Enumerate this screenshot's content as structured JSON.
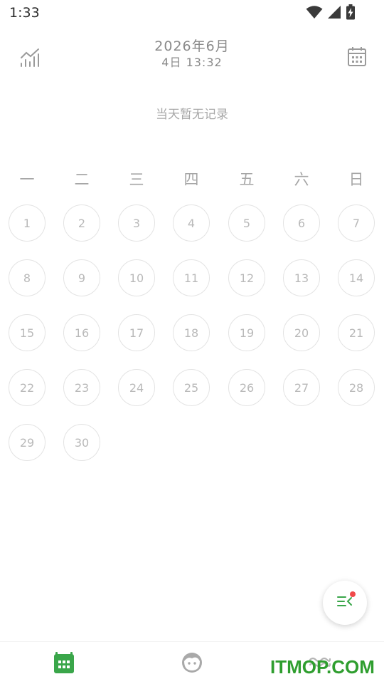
{
  "status_bar": {
    "time": "1:33",
    "icons": [
      "wifi-icon",
      "signal-icon",
      "battery-charging-icon"
    ]
  },
  "header": {
    "stats_icon": "stats-chart-icon",
    "date_line1": "2026年6月",
    "date_line2": "4日 13:32",
    "calendar_icon": "calendar-icon"
  },
  "empty_message": "当天暂无记录",
  "weekdays": [
    "一",
    "二",
    "三",
    "四",
    "五",
    "六",
    "日"
  ],
  "days": [
    "1",
    "2",
    "3",
    "4",
    "5",
    "6",
    "7",
    "8",
    "9",
    "10",
    "11",
    "12",
    "13",
    "14",
    "15",
    "16",
    "17",
    "18",
    "19",
    "20",
    "21",
    "22",
    "23",
    "24",
    "25",
    "26",
    "27",
    "28",
    "29",
    "30"
  ],
  "fab": {
    "icon": "menu-collapse-icon",
    "has_badge": true,
    "badge_color": "#f04a4a"
  },
  "bottom_nav": {
    "items": [
      {
        "icon": "calendar-icon",
        "active": true
      },
      {
        "icon": "face-icon",
        "active": false
      },
      {
        "icon": "waves-icon",
        "active": false
      }
    ]
  },
  "watermark": "ITMOP.COM",
  "colors": {
    "accent": "#3aa64a",
    "text_muted": "#a8a8a8",
    "circle_border": "#e3e3e3"
  }
}
